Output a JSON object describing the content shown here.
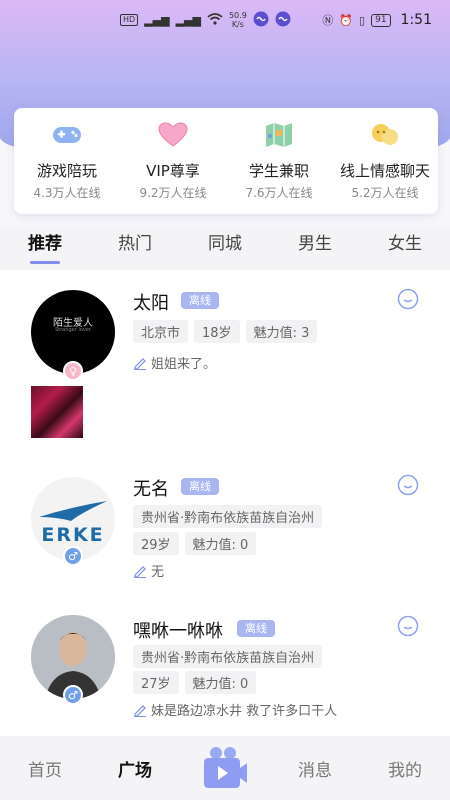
{
  "status_bar": {
    "network_speed": "50.9",
    "network_unit": "K/s",
    "battery": "91",
    "time": "1:51"
  },
  "features": [
    {
      "title": "游戏陪玩",
      "online": "4.3万人在线",
      "icon": "gamepad-icon"
    },
    {
      "title": "VIP尊享",
      "online": "9.2万人在线",
      "icon": "heart-icon"
    },
    {
      "title": "学生兼职",
      "online": "7.6万人在线",
      "icon": "map-icon"
    },
    {
      "title": "线上情感聊天",
      "online": "5.2万人在线",
      "icon": "chat-bubbles-icon"
    }
  ],
  "tabs": [
    "推荐",
    "热门",
    "同城",
    "男生",
    "女生"
  ],
  "posts": [
    {
      "name": "太阳",
      "badge": "离线",
      "avatar_text": "陌生爱人",
      "avatar_subtext": "Stranger lover",
      "tags": [
        "北京市",
        "18岁",
        "魅力值: 3"
      ],
      "status": "姐姐来了。"
    },
    {
      "name": "无名",
      "badge": "离线",
      "avatar_text": "ERKE",
      "tags": [
        "贵州省·黔南布依族苗族自治州",
        "29岁",
        "魅力值: 0"
      ],
      "status": "无"
    },
    {
      "name": "嘿咻一咻咻",
      "badge": "离线",
      "tags": [
        "贵州省·黔南布依族苗族自治州",
        "27岁",
        "魅力值: 0"
      ],
      "status": "妹是路边凉水井 救了许多口干人"
    }
  ],
  "nav": [
    "首页",
    "广场",
    "消息",
    "我的"
  ],
  "colors": {
    "accent": "#7f8df0",
    "badge": "#a9b6f1"
  }
}
